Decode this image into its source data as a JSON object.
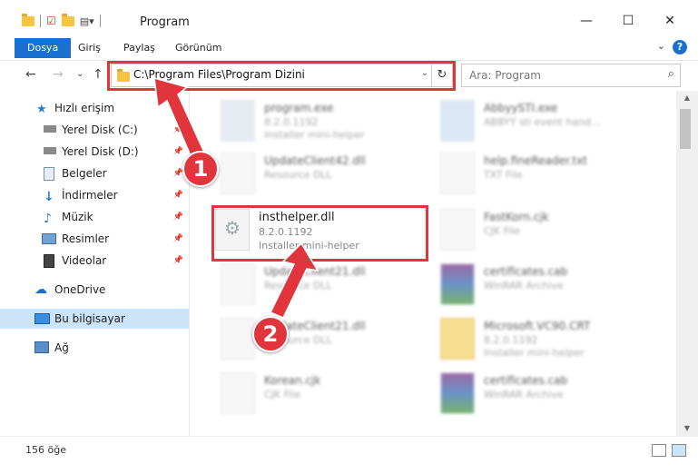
{
  "window": {
    "title": "Program",
    "minimize": "—",
    "maximize": "☐",
    "close": "✕"
  },
  "ribbon": {
    "tabs": [
      "Dosya",
      "Giriş",
      "Paylaş",
      "Görünüm"
    ],
    "help": "?"
  },
  "nav": {
    "back": "←",
    "forward": "→",
    "recent": "⌄",
    "up": "↑"
  },
  "address": {
    "path": "C:\\Program Files\\Program Dizini",
    "dropdown": "⌄",
    "refresh": "↻"
  },
  "search": {
    "placeholder": "Ara: Program",
    "icon": "⌕"
  },
  "sidebar": {
    "items": [
      {
        "label": "Hızlı erişim",
        "icon": "star-icon"
      },
      {
        "label": "Yerel Disk (C:)",
        "icon": "drive-icon",
        "pinned": true
      },
      {
        "label": "Yerel Disk (D:)",
        "icon": "drive-icon",
        "pinned": true
      },
      {
        "label": "Belgeler",
        "icon": "documents-icon",
        "pinned": true
      },
      {
        "label": "İndirmeler",
        "icon": "download-icon",
        "pinned": true
      },
      {
        "label": "Müzik",
        "icon": "music-icon",
        "pinned": true
      },
      {
        "label": "Resimler",
        "icon": "pictures-icon",
        "pinned": true
      },
      {
        "label": "Videolar",
        "icon": "videos-icon",
        "pinned": true
      },
      {
        "label": "OneDrive",
        "icon": "cloud-icon"
      },
      {
        "label": "Bu bilgisayar",
        "icon": "computer-icon",
        "selected": true
      },
      {
        "label": "Ağ",
        "icon": "network-icon"
      }
    ],
    "pin_glyph": "📌"
  },
  "files": {
    "left": [
      {
        "name": "program.exe",
        "version": "8.2.0.1192",
        "desc": "Installer mini-helper"
      },
      {
        "name": "UpdateClient42.dll",
        "version": "",
        "desc": "Resource DLL"
      },
      {
        "name": "insthelper.dll",
        "version": "8.2.0.1192",
        "desc": "Installer mini-helper"
      },
      {
        "name": "UpdateClient21.dll",
        "version": "",
        "desc": "Resource DLL"
      },
      {
        "name": "UpdateClient21.dll",
        "version": "",
        "desc": "Resource DLL"
      },
      {
        "name": "Korean.cjk",
        "version": "",
        "desc": "CJK File"
      }
    ],
    "right": [
      {
        "name": "AbbyySTI.exe",
        "version": "",
        "desc": "ABBYY sti event hand..."
      },
      {
        "name": "help.fineReader.txt",
        "version": "",
        "desc": "TXT File"
      },
      {
        "name": "FastKorn.cjk",
        "version": "",
        "desc": "CJK File"
      },
      {
        "name": "certificates.cab",
        "version": "",
        "desc": "WinRAR Archive"
      },
      {
        "name": "Microsoft.VC90.CRT",
        "version": "8.2.0.1192",
        "desc": "Installer mini-helper"
      },
      {
        "name": "certificates.cab",
        "version": "",
        "desc": "WinRAR Archive"
      }
    ]
  },
  "status": {
    "count": "156 öğe"
  },
  "annotations": {
    "badge1": "1",
    "badge2": "2",
    "color": "#e0353d"
  },
  "colors": {
    "accent": "#1a6fcf",
    "selected_bg": "#cce4f7",
    "folder": "#f5c542"
  }
}
